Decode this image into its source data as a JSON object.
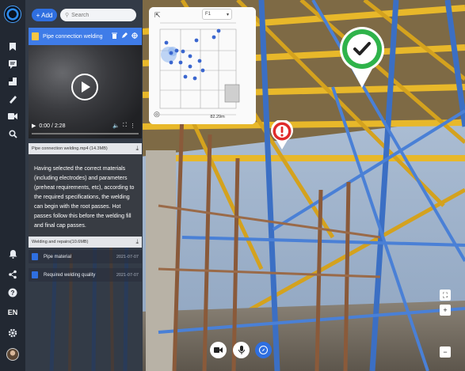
{
  "toolbar": {
    "add_label": "+ Add",
    "search_placeholder": "Search"
  },
  "item": {
    "title": "Pipe connection welding",
    "icon": "document-icon",
    "actions": [
      "trash-icon",
      "pencil-icon",
      "target-icon"
    ]
  },
  "video": {
    "time": "0:00 / 2:28",
    "controls": [
      "play-icon",
      "volume-icon",
      "fullscreen-icon",
      "more-icon"
    ]
  },
  "attachment_video": {
    "name": "Pipe connection welding.mp4 (14.3MB)"
  },
  "description": "Having selected the correct materials (including electrodes) and parameters (preheat requirements, etc), according to the required specifications, the welding can begin with the root passes. Hot passes follow this before the welding fill and final cap passes.",
  "attachment_doc": {
    "name": "Welding and repairs(10.6MB)"
  },
  "sub_items": [
    {
      "label": "Pipe material",
      "meta": "2021-07-07"
    },
    {
      "label": "Required welding quality",
      "meta": "2021-07-07"
    }
  ],
  "minimap": {
    "floor": "F1",
    "scale": "82.29m"
  },
  "language": "EN",
  "rail_icons": [
    "bookmark-icon",
    "chat-icon",
    "layers-icon",
    "measure-icon",
    "video-camera-icon",
    "search-icon"
  ],
  "rail_bottom_icons": [
    "bell-icon",
    "share-icon",
    "help-icon"
  ],
  "colors": {
    "accent": "#2f6fe0",
    "marker_ok": "#2fb34a",
    "marker_alert": "#e02b2b"
  }
}
